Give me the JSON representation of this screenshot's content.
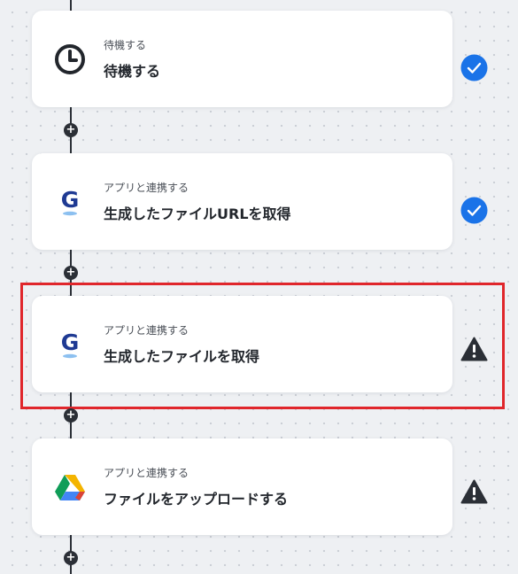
{
  "flow": {
    "steps": [
      {
        "subtitle": "待機する",
        "title": "待機する",
        "icon": "clock-icon",
        "status": "completed"
      },
      {
        "subtitle": "アプリと連携する",
        "title": "生成したファイルURLを取得",
        "icon": "gamma-app-icon",
        "status": "completed"
      },
      {
        "subtitle": "アプリと連携する",
        "title": "生成したファイルを取得",
        "icon": "gamma-app-icon",
        "status": "warning",
        "highlighted": true
      },
      {
        "subtitle": "アプリと連携する",
        "title": "ファイルをアップロードする",
        "icon": "google-drive-icon",
        "status": "warning"
      }
    ],
    "add_node_symbol": "+"
  },
  "colors": {
    "check_badge": "#1a73e8",
    "warning": "#2b2f36",
    "highlight_border": "#e0262b",
    "connector": "#2b2f36"
  }
}
